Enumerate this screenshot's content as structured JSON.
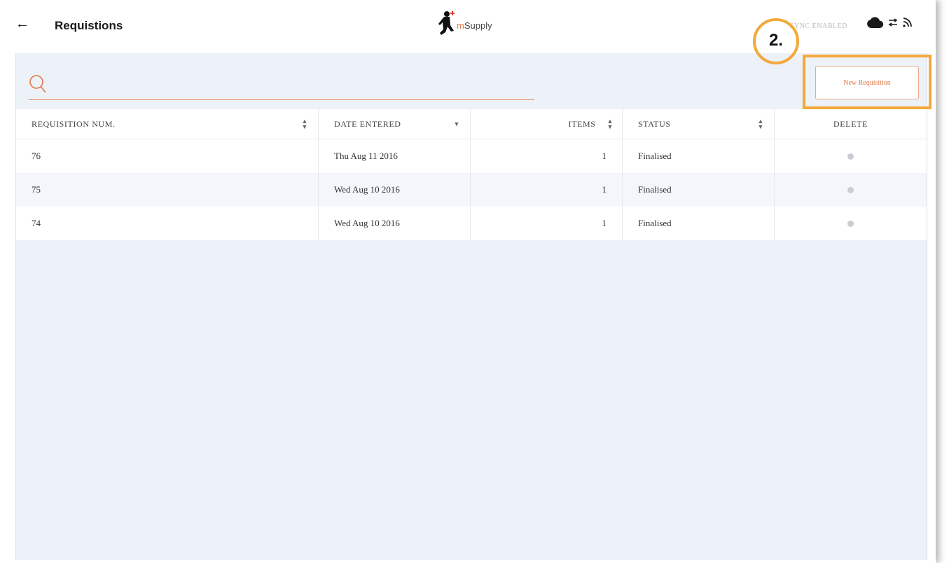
{
  "header": {
    "title": "Requistions",
    "logo_prefix": "m",
    "logo_suffix": "Supply",
    "sync_status": "SYNC ENABLED"
  },
  "annotation": {
    "step_label": "2."
  },
  "search": {
    "placeholder": "",
    "value": ""
  },
  "new_button_label": "New Requisition",
  "table": {
    "columns": [
      "REQUISITION NUM.",
      "DATE ENTERED",
      "ITEMS",
      "STATUS",
      "DELETE"
    ],
    "rows": [
      {
        "num": "76",
        "date": "Thu Aug 11 2016",
        "items": "1",
        "status": "Finalised"
      },
      {
        "num": "75",
        "date": "Wed Aug 10 2016",
        "items": "1",
        "status": "Finalised"
      },
      {
        "num": "74",
        "date": "Wed Aug 10 2016",
        "items": "1",
        "status": "Finalised"
      }
    ]
  },
  "icons": {
    "back": "arrow-left-icon",
    "search": "search-icon",
    "cloud": "cloud-icon",
    "sync": "sync-arrows-icon",
    "signal": "wifi-signal-icon",
    "delete": "delete-dot-icon",
    "logo": "mSupply-runner-logo"
  },
  "colors": {
    "accent": "#e0784a",
    "annotation": "#f3a93a",
    "background": "#edf1f8"
  }
}
